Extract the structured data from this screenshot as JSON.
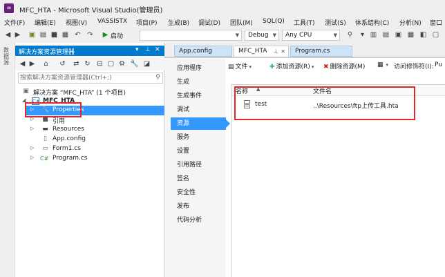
{
  "window": {
    "title": "MFC_HTA - Microsoft Visual Studio(管理员)"
  },
  "menu": [
    "文件(F)",
    "编辑(E)",
    "视图(V)",
    "VASSISTX",
    "项目(P)",
    "生成(B)",
    "调试(D)",
    "团队(M)",
    "SQL(Q)",
    "工具(T)",
    "测试(S)",
    "体系结构(C)",
    "分析(N)",
    "窗口"
  ],
  "toolbar": {
    "start_label": "启动",
    "config_value": "Debug",
    "platform_value": "Any CPU"
  },
  "left_strip": {
    "vertical_text": "数据源"
  },
  "solution_explorer": {
    "title": "解决方案资源管理器",
    "search_placeholder": "搜索解决方案资源管理器(Ctrl+;)",
    "tree": [
      {
        "label": "解决方案 “MFC_HTA” (1 个项目)",
        "icon": "solution-icon"
      },
      {
        "label": "MFC_HTA",
        "icon": "csharp-project-icon"
      },
      {
        "label": "Properties",
        "icon": "wrench-icon"
      },
      {
        "label": "引用",
        "icon": "references-icon"
      },
      {
        "label": "Resources",
        "icon": "folder-icon"
      },
      {
        "label": "App.config",
        "icon": "config-file-icon"
      },
      {
        "label": "Form1.cs",
        "icon": "form-icon"
      },
      {
        "label": "Program.cs",
        "icon": "csharp-file-icon"
      }
    ]
  },
  "doc_tabs": [
    {
      "label": "App.config"
    },
    {
      "label": "MFC_HTA"
    },
    {
      "label": "Program.cs"
    }
  ],
  "properties_nav": [
    "应用程序",
    "生成",
    "生成事件",
    "调试",
    "资源",
    "服务",
    "设置",
    "引用路径",
    "签名",
    "安全性",
    "发布",
    "代码分析"
  ],
  "resource_toolbar": {
    "file_label": "文件",
    "add_label": "添加资源(R)",
    "remove_label": "删除资源(M)",
    "access_label": "访问修饰符(I):",
    "access_value": "Pu"
  },
  "resource_grid": {
    "col_name": "名称",
    "col_file": "文件名",
    "rows": [
      {
        "name": "test",
        "file": "..\\Resources\\ftp上传工具.hta"
      }
    ]
  },
  "colors": {
    "accent": "#007acc",
    "selection": "#3399ff",
    "annotation_red": "#e0262b"
  }
}
